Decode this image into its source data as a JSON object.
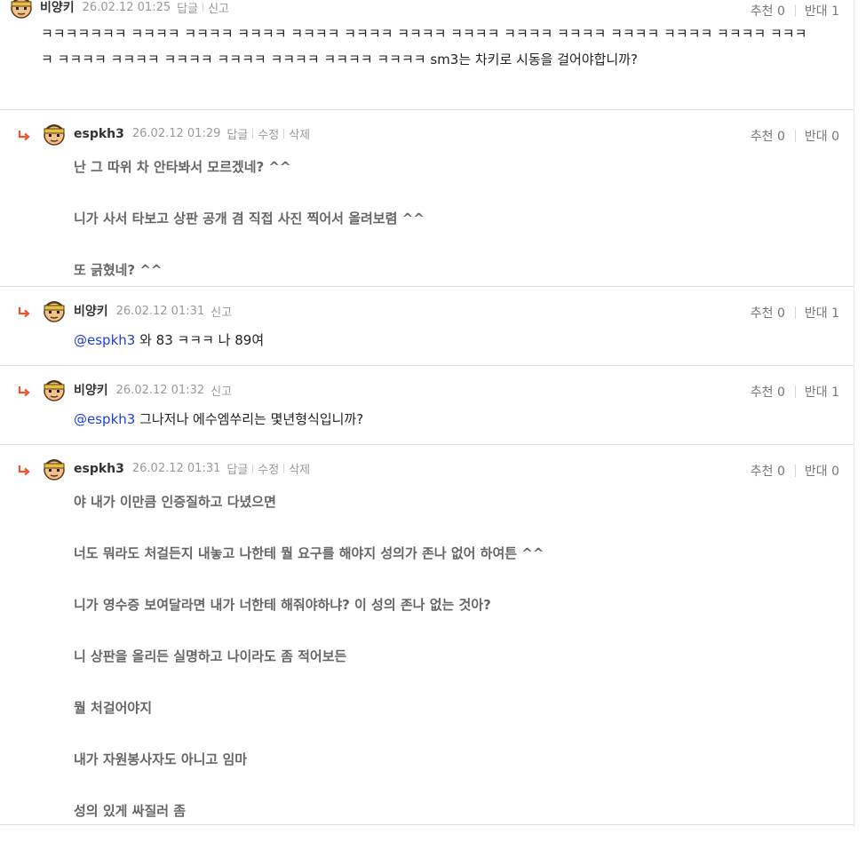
{
  "colors": {
    "mention": "#1f3fd6",
    "reply_arrow": "#e8572a",
    "meta_text": "#999999",
    "divider": "#dcdcdc"
  },
  "comments": [
    {
      "author": "비양키",
      "date": "26.02.12 01:25",
      "actions": [
        "답글",
        "신고"
      ],
      "upvote_label": "추천 0",
      "downvote_label": "반대 1",
      "text": "ㅋㅋㅋㅋㅋㅋㅋ ㅋㅋㅋㅋ ㅋㅋㅋㅋ ㅋㅋㅋㅋ ㅋㅋㅋㅋ ㅋㅋㅋㅋ ㅋㅋㅋㅋ ㅋㅋㅋㅋ ㅋㅋㅋㅋ ㅋㅋㅋㅋ ㅋㅋㅋㅋ ㅋㅋㅋㅋ ㅋㅋㅋㅋ ㅋㅋㅋㅋ ㅋㅋㅋㅋ ㅋㅋㅋㅋ ㅋㅋㅋㅋ ㅋㅋㅋㅋ ㅋㅋㅋㅋ ㅋㅋㅋㅋ ㅋㅋㅋㅋ sm3는 차키로 시동을 걸어야합니까?"
    },
    {
      "author": "espkh3",
      "date": "26.02.12 01:29",
      "actions": [
        "답글",
        "수정",
        "삭제"
      ],
      "upvote_label": "추천 0",
      "downvote_label": "반대 0",
      "paragraphs": [
        "난 그 따위 차 안타봐서 모르겠네? ^^",
        "니가 사서 타보고 상판 공개 겸 직접 사진 찍어서 올려보렴 ^^",
        "또 긁혔네? ^^"
      ]
    },
    {
      "author": "비양키",
      "date": "26.02.12 01:31",
      "actions": [
        "신고"
      ],
      "upvote_label": "추천 0",
      "downvote_label": "반대 1",
      "mention": "@espkh3",
      "text": " 와 83 ㅋㅋㅋ 나 89여"
    },
    {
      "author": "비양키",
      "date": "26.02.12 01:32",
      "actions": [
        "신고"
      ],
      "upvote_label": "추천 0",
      "downvote_label": "반대 1",
      "mention": "@espkh3",
      "text": " 그나저나 에수엠쑤리는 몇년형식입니까?"
    },
    {
      "author": "espkh3",
      "date": "26.02.12 01:31",
      "actions": [
        "답글",
        "수정",
        "삭제"
      ],
      "upvote_label": "추천 0",
      "downvote_label": "반대 0",
      "paragraphs": [
        "야 내가 이만큼 인증질하고 다녔으면",
        "너도 뭐라도 처걸든지 내놓고 나한테 뭘 요구를 해야지 성의가 존나 없어 하여튼 ^^",
        "니가 영수증 보여달라면 내가 너한테 해줘야하냐? 이 성의 존나 없는 것아?",
        "니 상판을 올리든 실명하고 나이라도 좀 적어보든",
        "뭘 처걸어야지",
        "내가 자원봉사자도 아니고 임마",
        "성의 있게 싸질러 좀"
      ]
    }
  ]
}
